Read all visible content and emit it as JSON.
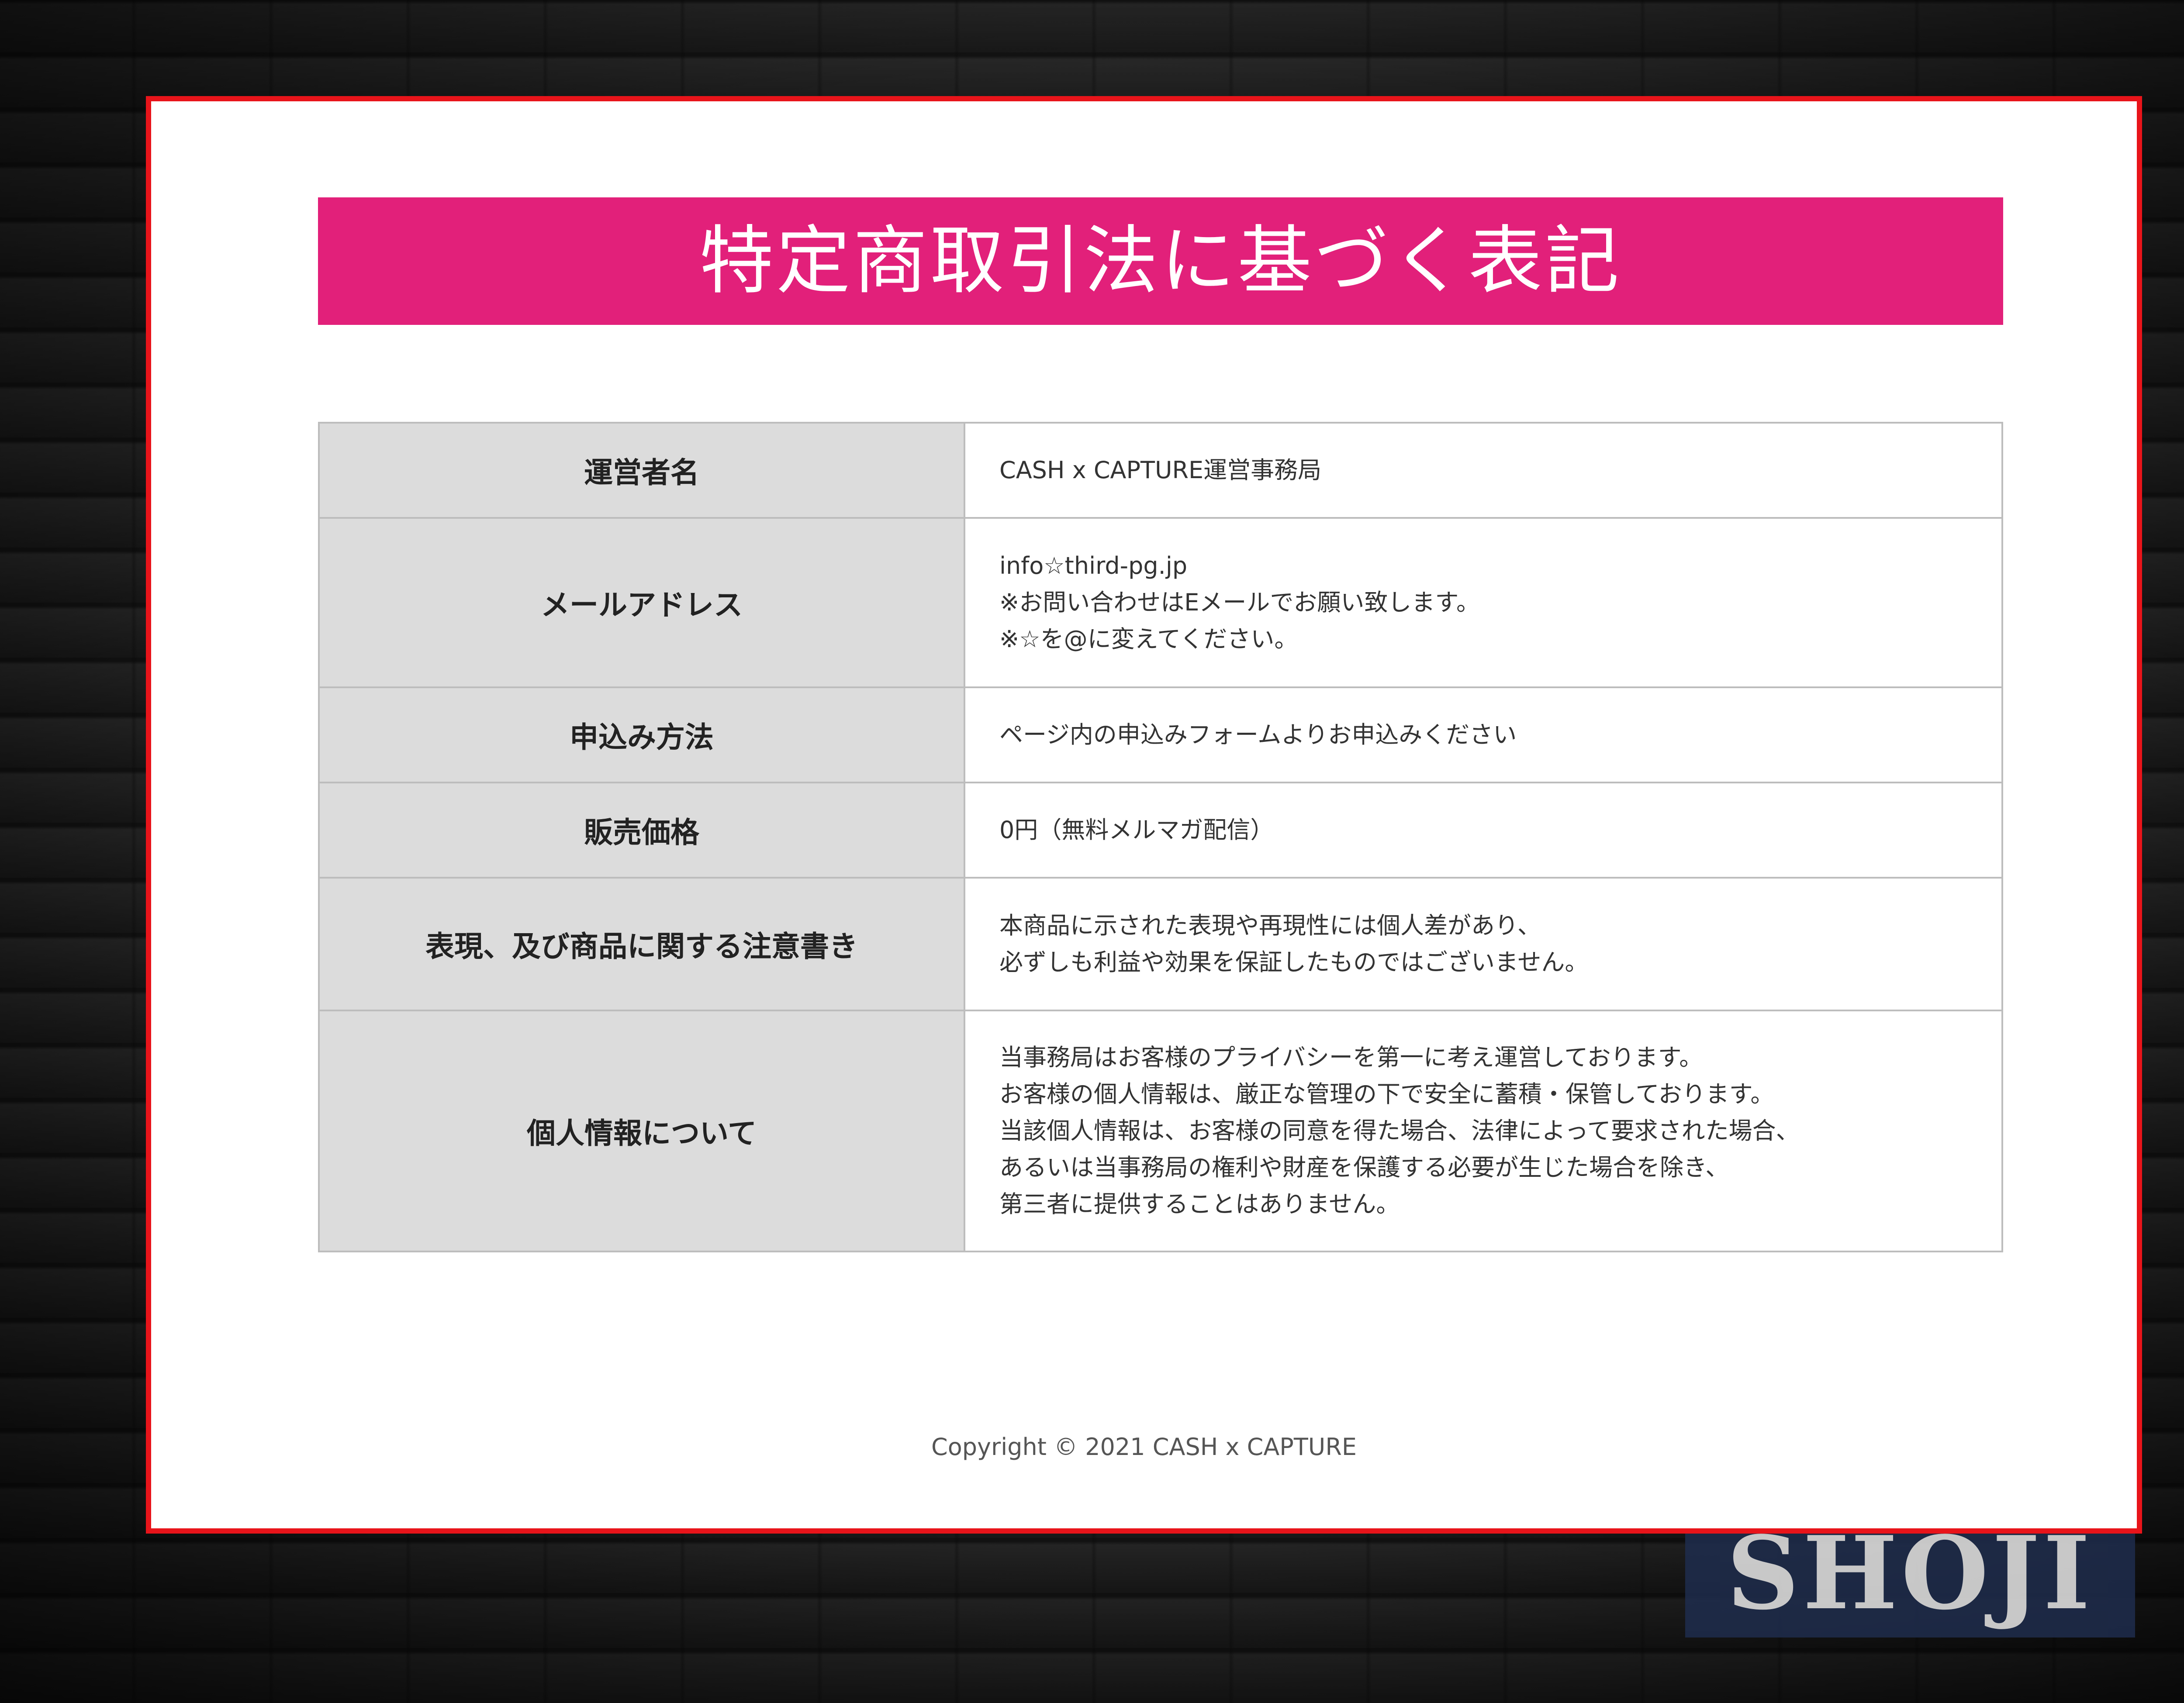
{
  "page": {
    "title": "特定商取引法に基づく表記",
    "brand_colors": {
      "accent": "#e2207a",
      "frame": "#e8141a",
      "label_bg": "#dcdcdc"
    }
  },
  "table": {
    "rows": [
      {
        "label": "運営者名",
        "value": "CASH x CAPTURE運営事務局"
      },
      {
        "label": "メールアドレス",
        "value": "info☆third-pg.jp\n※お問い合わせはEメールでお願い致します。\n※☆を@に変えてください。"
      },
      {
        "label": "申込み方法",
        "value": "ページ内の申込みフォームよりお申込みください"
      },
      {
        "label": "販売価格",
        "value": "0円（無料メルマガ配信）"
      },
      {
        "label": "表現、及び商品に関する注意書き",
        "value": "本商品に示された表現や再現性には個人差があり、\n必ずしも利益や効果を保証したものではございません。"
      },
      {
        "label": "個人情報について",
        "value": "当事務局はお客様のプライバシーを第一に考え運営しております。\nお客様の個人情報は、厳正な管理の下で安全に蓄積・保管しております。\n当該個人情報は、お客様の同意を得た場合、法律によって要求された場合、\nあるいは当事務局の権利や財産を保護する必要が生じた場合を除き、\n第三者に提供することはありません。"
      }
    ]
  },
  "footer": {
    "copyright": "Copyright © 2021 CASH x CAPTURE"
  },
  "watermark": {
    "text": "SHOJI"
  }
}
